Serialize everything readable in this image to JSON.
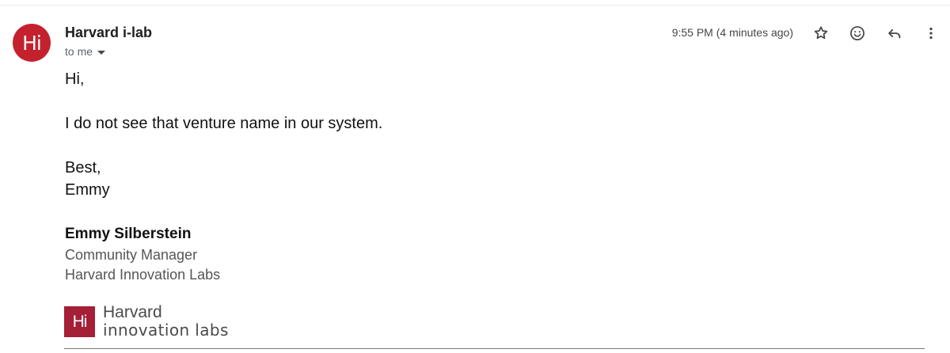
{
  "email": {
    "sender": {
      "name": "Harvard i-lab",
      "avatar_text": "Hi",
      "avatar_color": "#c4212f"
    },
    "recipient_label": "to me",
    "timestamp": "9:55 PM (4 minutes ago)",
    "actions": {
      "star_icon": "star-outline",
      "emoji_icon": "smiley-face",
      "reply_icon": "reply-arrow",
      "more_icon": "vertical-ellipsis"
    },
    "body": {
      "greeting": "Hi,",
      "message": "I do not see that venture name in our system.",
      "signoff": "Best,",
      "signname": "Emmy"
    },
    "signature": {
      "name": "Emmy Silberstein",
      "title": "Community Manager",
      "organization": "Harvard Innovation Labs",
      "logo": {
        "mark": "Hi",
        "line1": "Harvard",
        "line2": "innovation labs",
        "color": "#a51f37"
      }
    }
  }
}
